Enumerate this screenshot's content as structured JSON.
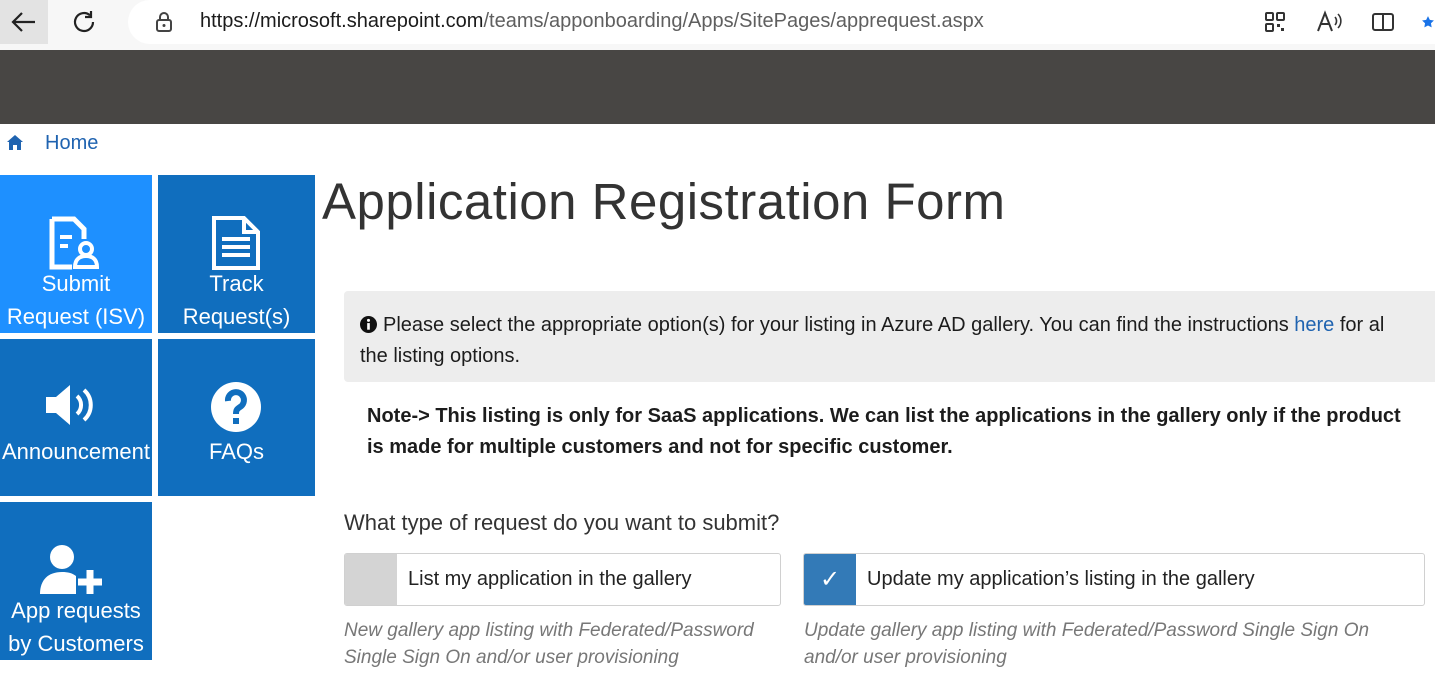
{
  "browser": {
    "url_host": "https://microsoft.sharepoint.com",
    "url_path": "/teams/apponboarding/Apps/SitePages/apprequest.aspx"
  },
  "breadcrumb": {
    "home_label": "Home"
  },
  "tiles": [
    {
      "label": "Submit\nRequest (ISV)",
      "icon": "form-user-icon"
    },
    {
      "label": "Track\nRequest(s)",
      "icon": "document-icon"
    },
    {
      "label": "Announcement",
      "icon": "speaker-icon"
    },
    {
      "label": "FAQs",
      "icon": "question-circle-icon"
    },
    {
      "label": "App requests\nby Customers",
      "icon": "add-user-icon"
    }
  ],
  "main": {
    "title": "Application Registration Form",
    "info": {
      "line1_before": "Please select the appropriate option(s) for your listing in Azure AD gallery. You can find the instructions ",
      "link": "here",
      "line1_after": " for al",
      "line2": "the listing options."
    },
    "note": {
      "line1": "Note-> This listing is only for SaaS applications. We can list the applications in the gallery only if the product",
      "line2": "is made for multiple customers and not for specific customer."
    },
    "question": "What type of request do you want to submit?",
    "options": [
      {
        "label": "List my application in the gallery",
        "checked": false,
        "description": "New gallery app listing with Federated/Password\nSingle Sign On and/or user provisioning"
      },
      {
        "label": "Update my application’s listing in the gallery",
        "checked": true,
        "description": "Update gallery app listing with Federated/Password Single Sign On\nand/or user provisioning"
      }
    ]
  },
  "colors": {
    "tile_blue": "#106ebe",
    "tile_highlight": "#1e90ff",
    "header_dark": "#484644",
    "link": "#1f63b0",
    "checked": "#337ab7"
  }
}
